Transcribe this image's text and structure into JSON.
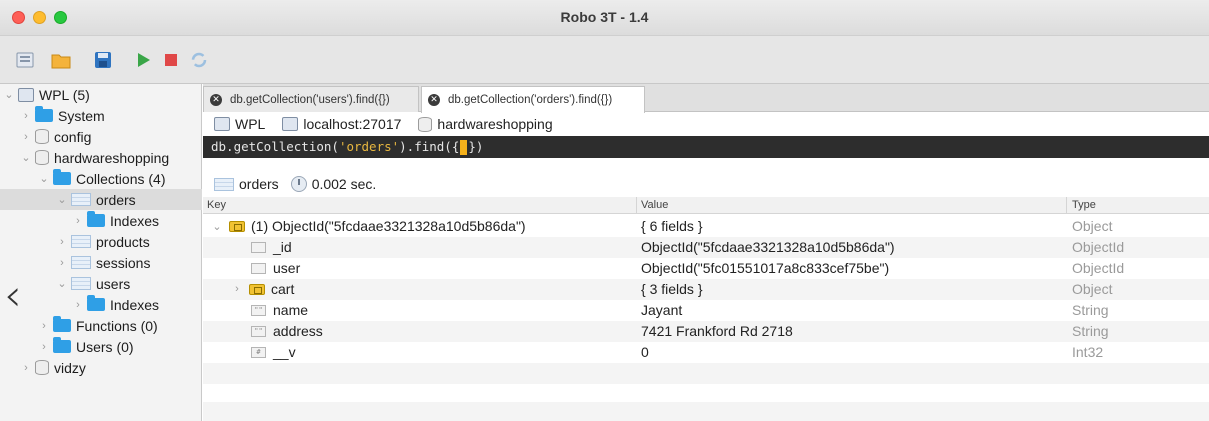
{
  "window": {
    "title": "Robo 3T - 1.4"
  },
  "toolbar": {
    "buttons": [
      "connect-icon",
      "open-folder-icon",
      "save-icon",
      "run-icon",
      "stop-icon",
      "refresh-icon"
    ]
  },
  "sidebar": {
    "items": [
      {
        "label": "WPL (5)",
        "icon": "server-icon"
      },
      {
        "label": "System",
        "icon": "folder-icon"
      },
      {
        "label": "config",
        "icon": "database-icon"
      },
      {
        "label": "hardwareshopping",
        "icon": "database-icon"
      },
      {
        "label": "Collections (4)",
        "icon": "folder-icon"
      },
      {
        "label": "orders",
        "icon": "collection-icon"
      },
      {
        "label": "Indexes",
        "icon": "folder-icon"
      },
      {
        "label": "products",
        "icon": "collection-icon"
      },
      {
        "label": "sessions",
        "icon": "collection-icon"
      },
      {
        "label": "users",
        "icon": "collection-icon"
      },
      {
        "label": "Indexes",
        "icon": "folder-icon"
      },
      {
        "label": "Functions (0)",
        "icon": "folder-icon"
      },
      {
        "label": "Users (0)",
        "icon": "folder-icon"
      },
      {
        "label": "vidzy",
        "icon": "database-icon"
      }
    ]
  },
  "tabs": [
    {
      "label": "db.getCollection('users').find({})",
      "active": false
    },
    {
      "label": "db.getCollection('orders').find({})",
      "active": true
    }
  ],
  "breadcrumb": {
    "connection": "WPL",
    "host": "localhost:27017",
    "database": "hardwareshopping"
  },
  "query": {
    "prefix": "db.getCollection(",
    "collection": "'orders'",
    "middle": ").find(",
    "open": "{",
    "close": "})"
  },
  "result": {
    "collection": "orders",
    "time": "0.002 sec."
  },
  "table": {
    "headers": {
      "key": "Key",
      "value": "Value",
      "type": "Type"
    },
    "rows": [
      {
        "key": "(1) ObjectId(\"5fcdaae3321328a10d5b86da\")",
        "value": "{ 6 fields }",
        "type": "Object",
        "icon": "object-icon"
      },
      {
        "key": "_id",
        "value": "ObjectId(\"5fcdaae3321328a10d5b86da\")",
        "type": "ObjectId",
        "icon": "field-icon"
      },
      {
        "key": "user",
        "value": "ObjectId(\"5fc01551017a8c833cef75be\")",
        "type": "ObjectId",
        "icon": "field-icon"
      },
      {
        "key": "cart",
        "value": "{ 3 fields }",
        "type": "Object",
        "icon": "object-icon"
      },
      {
        "key": "name",
        "value": "Jayant",
        "type": "String",
        "icon": "string-field-icon"
      },
      {
        "key": "address",
        "value": "7421 Frankford Rd 2718",
        "type": "String",
        "icon": "string-field-icon"
      },
      {
        "key": "__v",
        "value": "0",
        "type": "Int32",
        "icon": "int-field-icon"
      }
    ]
  },
  "colors": {
    "sidebar_bg": "#f3f3f3",
    "folder": "#2f9fe6",
    "query_bg": "#2d2d2d",
    "query_string": "#e8b740",
    "cursor": "#f6b21b"
  }
}
